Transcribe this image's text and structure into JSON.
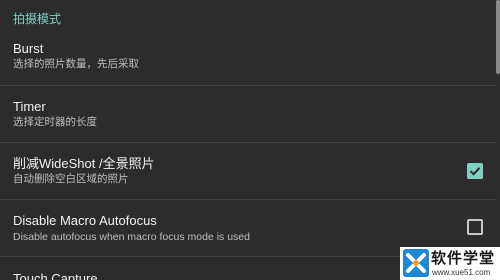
{
  "section": {
    "title": "拍摄模式"
  },
  "preferences": [
    {
      "title": "Burst",
      "summary": "选择的照片数量，先后采取"
    },
    {
      "title": "Timer",
      "summary": "选择定时器的长度"
    },
    {
      "title": "削减WideShot /全景照片",
      "summary": "自动删除空白区域的照片",
      "checked": true
    },
    {
      "title": "Disable Macro Autofocus",
      "summary": "Disable autofocus when macro focus mode is used",
      "checked": false
    },
    {
      "title": "Touch Capture"
    }
  ],
  "watermark": {
    "brand": "软件学堂",
    "url": "www.xue51.com"
  },
  "colors": {
    "accent": "#7fcfc3",
    "background": "#2c2c2c",
    "divider": "#3f3f3f"
  },
  "icons": {
    "checked": "checkbox-checked-icon",
    "unchecked": "checkbox-unchecked-icon"
  }
}
